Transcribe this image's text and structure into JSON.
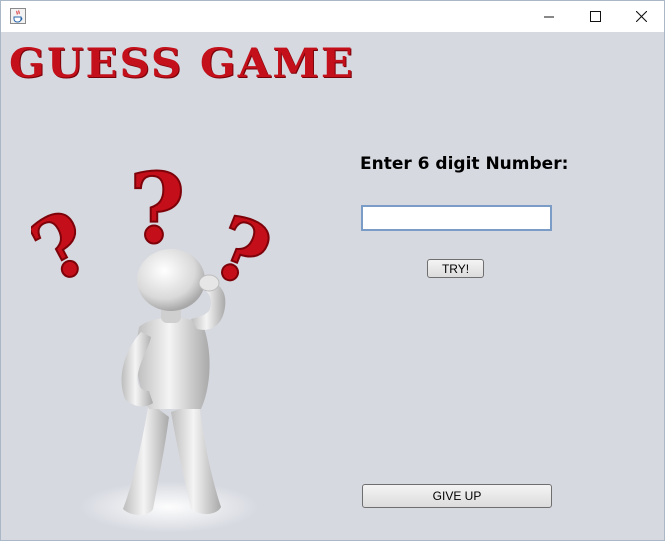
{
  "window": {
    "controls": {
      "minimize": "—",
      "maximize": "☐",
      "close": "✕"
    }
  },
  "game": {
    "title": "GUESS GAME",
    "prompt": "Enter 6 digit Number:",
    "input_value": "",
    "try_label": "TRY!",
    "giveup_label": "GIVE UP"
  },
  "colors": {
    "title": "#c4101a",
    "background": "#d6d9e0"
  },
  "icons": {
    "app": "java-coffee-cup-icon",
    "illustration": "thinking-figure-with-question-marks"
  }
}
